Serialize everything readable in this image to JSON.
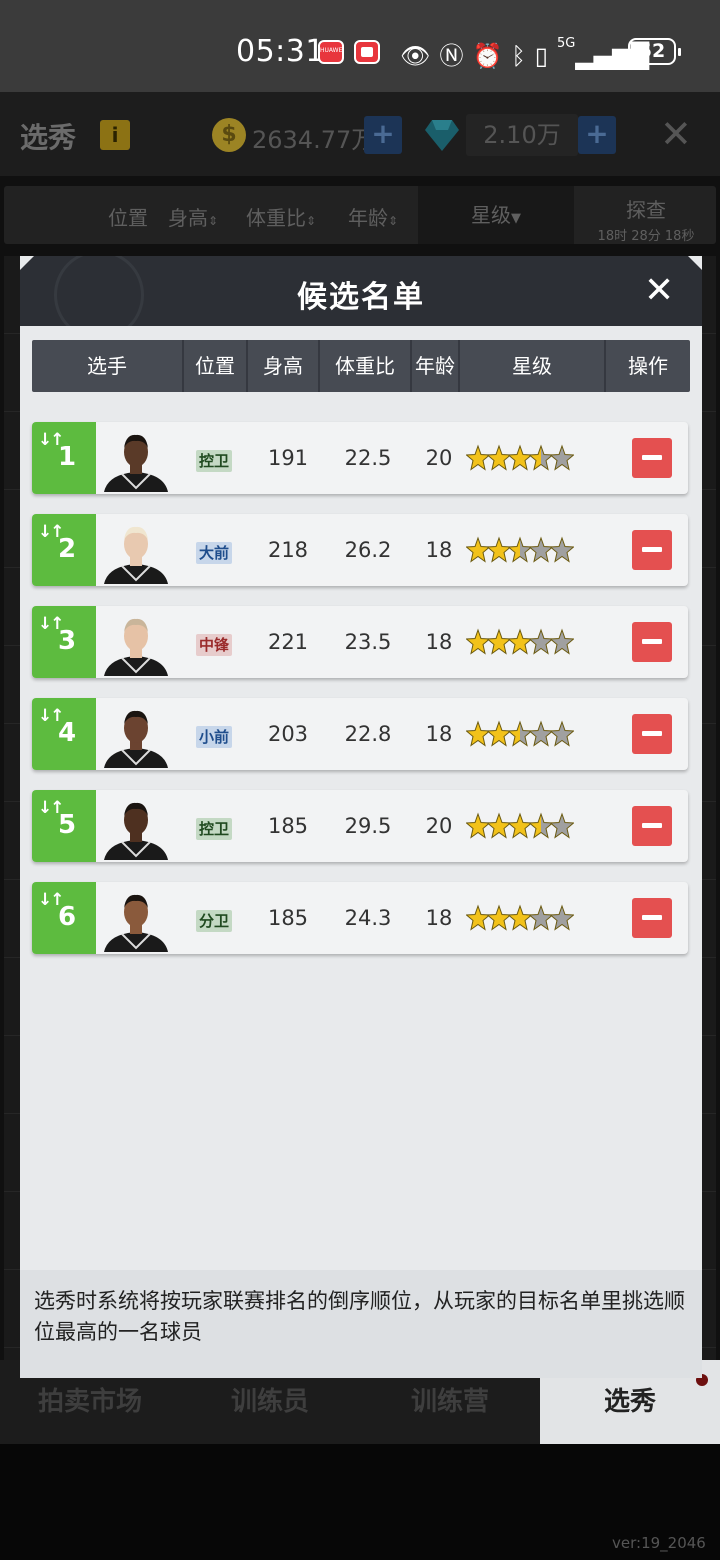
{
  "status_bar": {
    "time": "05:31",
    "battery": "52",
    "network": "5G",
    "icons": [
      "eye-icon",
      "nfc-icon",
      "alarm-icon",
      "bluetooth-icon",
      "vibrate-icon",
      "signal-icon"
    ],
    "app1_label": "HUAWEI"
  },
  "header": {
    "title": "选秀",
    "info": "i",
    "coins": "2634.77万",
    "gems": "2.10万",
    "plus": "+",
    "close": "✕"
  },
  "filters": {
    "position": "位置",
    "height": "身高",
    "weight_ratio": "体重比",
    "age": "年龄",
    "stars": "星级",
    "scout": "探查",
    "scout_timer": "18时 28分 18秒"
  },
  "modal": {
    "title": "候选名单",
    "close": "✕",
    "columns": [
      "选手",
      "位置",
      "身高",
      "体重比",
      "年龄",
      "星级",
      "操作"
    ],
    "rows": [
      {
        "rank": "1",
        "position": "控卫",
        "pos_color": "green",
        "height": "191",
        "weight_ratio": "22.5",
        "age": "20",
        "stars_filled": 3.5,
        "stars_total": 5
      },
      {
        "rank": "2",
        "position": "大前",
        "pos_color": "blue",
        "height": "218",
        "weight_ratio": "26.2",
        "age": "18",
        "stars_filled": 2.5,
        "stars_total": 5
      },
      {
        "rank": "3",
        "position": "中锋",
        "pos_color": "red",
        "height": "221",
        "weight_ratio": "23.5",
        "age": "18",
        "stars_filled": 3,
        "stars_total": 5
      },
      {
        "rank": "4",
        "position": "小前",
        "pos_color": "blue",
        "height": "203",
        "weight_ratio": "22.8",
        "age": "18",
        "stars_filled": 2.5,
        "stars_total": 5
      },
      {
        "rank": "5",
        "position": "控卫",
        "pos_color": "green",
        "height": "185",
        "weight_ratio": "29.5",
        "age": "20",
        "stars_filled": 3.5,
        "stars_total": 5
      },
      {
        "rank": "6",
        "position": "分卫",
        "pos_color": "green",
        "height": "185",
        "weight_ratio": "24.3",
        "age": "18",
        "stars_filled": 3,
        "stars_total": 5
      }
    ],
    "note": "选秀时系统将按玩家联赛排名的倒序顺位，从玩家的目标名单里挑选顺位最高的一名球员"
  },
  "bottom_tabs": [
    "拍卖市场",
    "训练员",
    "训练营",
    "选秀"
  ],
  "active_tab": "选秀",
  "version": "ver:19_2046",
  "colors": {
    "rank_green": "#5dbb3f",
    "minus_red": "#e45050",
    "star_gold": "#f2c21a",
    "star_gray": "#a0a0a0",
    "modal_head": "#2c2f35"
  }
}
